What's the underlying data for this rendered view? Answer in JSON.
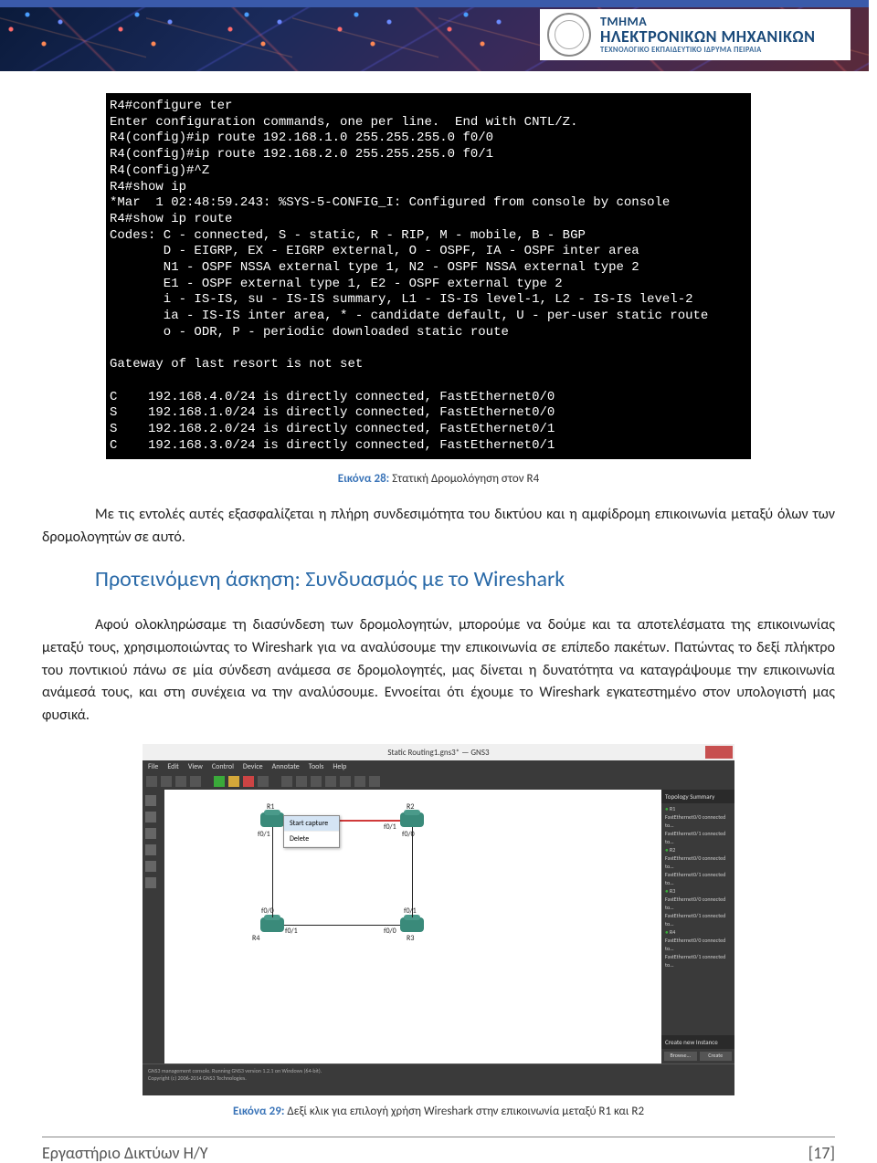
{
  "header": {
    "dept_line1": "ΤΜΗΜΑ",
    "dept_line2": "ΗΛΕΚΤΡΟΝΙΚΩΝ ΜΗΧΑΝΙΚΩΝ",
    "dept_line3": "ΤΕΧΝΟΛΟΓΙΚΟ ΕΚΠΑΙΔΕΥΤΙΚΟ ΙΔΡΥΜΑ ΠΕΙΡΑΙΑ"
  },
  "terminal_lines": "R4#configure ter\nEnter configuration commands, one per line.  End with CNTL/Z.\nR4(config)#ip route 192.168.1.0 255.255.255.0 f0/0\nR4(config)#ip route 192.168.2.0 255.255.255.0 f0/1\nR4(config)#^Z\nR4#show ip\n*Mar  1 02:48:59.243: %SYS-5-CONFIG_I: Configured from console by console\nR4#show ip route\nCodes: C - connected, S - static, R - RIP, M - mobile, B - BGP\n       D - EIGRP, EX - EIGRP external, O - OSPF, IA - OSPF inter area\n       N1 - OSPF NSSA external type 1, N2 - OSPF NSSA external type 2\n       E1 - OSPF external type 1, E2 - OSPF external type 2\n       i - IS-IS, su - IS-IS summary, L1 - IS-IS level-1, L2 - IS-IS level-2\n       ia - IS-IS inter area, * - candidate default, U - per-user static route\n       o - ODR, P - periodic downloaded static route\n\nGateway of last resort is not set\n\nC    192.168.4.0/24 is directly connected, FastEthernet0/0\nS    192.168.1.0/24 is directly connected, FastEthernet0/0\nS    192.168.2.0/24 is directly connected, FastEthernet0/1\nC    192.168.3.0/24 is directly connected, FastEthernet0/1",
  "caption28": {
    "label": "Εικόνα 28:",
    "text": " Στατική Δρομολόγηση στον R4"
  },
  "paragraph1": "Με τις εντολές αυτές εξασφαλίζεται η πλήρη συνδεσιμότητα του δικτύου και η αμφίδρομη επικοινωνία μεταξύ όλων των δρομολογητών σε αυτό.",
  "section_heading": "Προτεινόμενη άσκηση: Συνδυασμός με το Wireshark",
  "paragraph2": "Αφού ολοκληρώσαμε τη διασύνδεση των δρομολογητών, μπορούμε να δούμε και τα αποτελέσματα της επικοινωνίας μεταξύ τους, χρησιμοποιώντας το Wireshark για να αναλύσουμε την επικοινωνία σε επίπεδο πακέτων. Πατώντας το δεξί πλήκτρο του ποντικιού πάνω σε μία σύνδεση ανάμεσα σε δρομολογητές, μας δίνεται η δυνατότητα να καταγράψουμε την επικοινωνία ανάμεσά τους, και στη συνέχεια να την αναλύσουμε. Εννοείται ότι έχουμε το Wireshark εγκατεστημένο στον υπολογιστή μας φυσικά.",
  "gns3": {
    "title": "Static Routing1.gns3* — GNS3",
    "menu": [
      "File",
      "Edit",
      "View",
      "Control",
      "Device",
      "Annotate",
      "Tools",
      "Help"
    ],
    "context_items": [
      "Start capture",
      "Delete"
    ],
    "routers": {
      "r1": "R1",
      "r2": "R2",
      "r3": "R3",
      "r4": "R4"
    },
    "ports": {
      "f00": "f0/0",
      "f01": "f0/1"
    },
    "right_panel_title": "Topology Summary",
    "right_items": [
      "R1",
      "FastEthernet0/0 connected to...",
      "FastEthernet0/1 connected to...",
      "R2",
      "FastEthernet0/0 connected to...",
      "FastEthernet0/1 connected to...",
      "R3",
      "FastEthernet0/0 connected to...",
      "FastEthernet0/1 connected to...",
      "R4",
      "FastEthernet0/0 connected to...",
      "FastEthernet0/1 connected to..."
    ],
    "create_section": "Create new Instance",
    "btn_browse": "Browse...",
    "btn_create": "Create",
    "console_footer": "GNS3 management console. Running GNS3 version 1.2.1 on Windows (64-bit).\nCopyright (c) 2006-2014 GNS3 Technologies."
  },
  "caption29": {
    "label": "Εικόνα 29:",
    "text": " Δεξί κλικ για επιλογή χρήση Wireshark στην επικοινωνία μεταξύ R1 και R2"
  },
  "footer": {
    "left": "Εργαστήριο Δικτύων Η/Υ",
    "right": "[17]"
  }
}
